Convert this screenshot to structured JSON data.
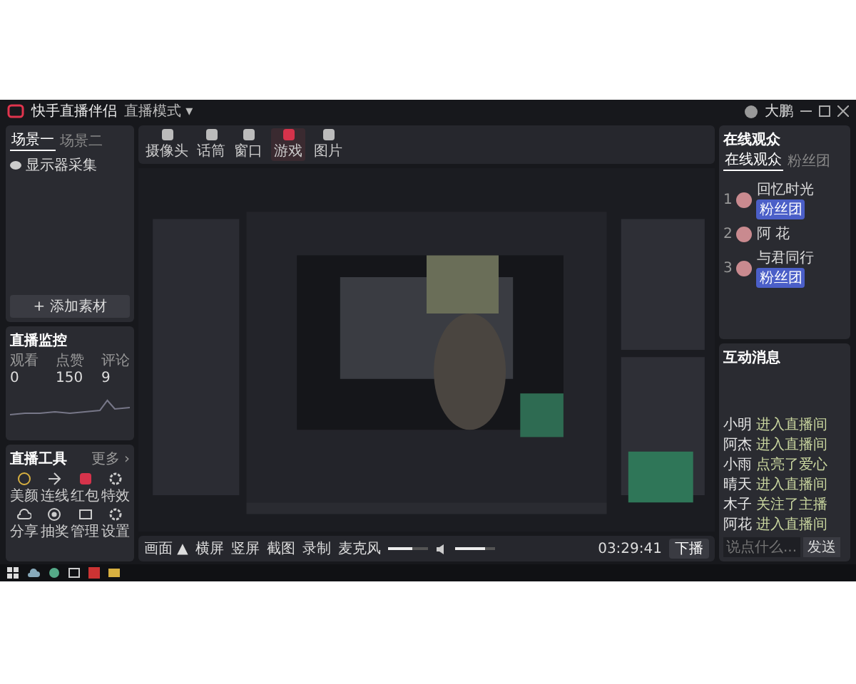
{
  "title_bar": {
    "app_name": "快手直播伴侣",
    "mode": "直播模式 ▾",
    "user": "大鹏"
  },
  "scenes": {
    "tabs": [
      {
        "label": "场景一",
        "selected": true
      },
      {
        "label": "场景二",
        "selected": false
      }
    ],
    "items": [
      {
        "label": "显示器采集",
        "visible": true
      }
    ],
    "add_button": "+ 添加素材"
  },
  "monitor": {
    "title": "直播监控",
    "stats": [
      {
        "label": "观看",
        "value": "0"
      },
      {
        "label": "点赞",
        "value": "150"
      },
      {
        "label": "评论",
        "value": "9"
      }
    ]
  },
  "tools": {
    "title": "直播工具",
    "more": "更多 ›",
    "items": [
      {
        "label": "美颜",
        "kind": "face"
      },
      {
        "label": "连线",
        "kind": "link"
      },
      {
        "label": "红包",
        "kind": "gift"
      },
      {
        "label": "特效",
        "kind": "gear"
      },
      {
        "label": "分享",
        "kind": "cloud"
      },
      {
        "label": "抽奖",
        "kind": "target"
      },
      {
        "label": "管理",
        "kind": "screen"
      },
      {
        "label": "设置",
        "kind": "gear"
      }
    ]
  },
  "toolbar": {
    "items": [
      {
        "label": "摄像头",
        "accent": false
      },
      {
        "label": "话筒",
        "accent": false
      },
      {
        "label": "窗口",
        "accent": false
      },
      {
        "label": "游戏",
        "accent": true
      },
      {
        "label": "图片",
        "accent": false
      }
    ]
  },
  "bottom_bar": {
    "scene": "画面 ▲",
    "buttons": [
      "横屏",
      "竖屏",
      "截图",
      "录制"
    ],
    "mic": {
      "label": "麦克风",
      "level": 0.6
    },
    "speaker": {
      "level": 0.75
    },
    "timer": "03:29:41",
    "end_button": "下播"
  },
  "viewers": {
    "title": "在线观众",
    "tabs": [
      {
        "label": "在线观众",
        "selected": true
      },
      {
        "label": "粉丝团",
        "selected": false
      }
    ],
    "list": [
      {
        "rank": "1",
        "name": "回忆时光",
        "badge": "粉丝团"
      },
      {
        "rank": "2",
        "name": "阿 花"
      },
      {
        "rank": "3",
        "name": "与君同行",
        "badge": "粉丝团"
      }
    ]
  },
  "messages": {
    "title": "互动消息",
    "list": [
      {
        "user": "小明",
        "text": "进入直播间"
      },
      {
        "user": "阿杰",
        "text": "进入直播间"
      },
      {
        "user": "小雨",
        "text": "点亮了爱心"
      },
      {
        "user": "晴天",
        "text": "进入直播间"
      },
      {
        "user": "木子",
        "text": "关注了主播"
      },
      {
        "user": "阿花",
        "text": "进入直播间"
      }
    ],
    "placeholder": "说点什么...",
    "send": "发送"
  }
}
